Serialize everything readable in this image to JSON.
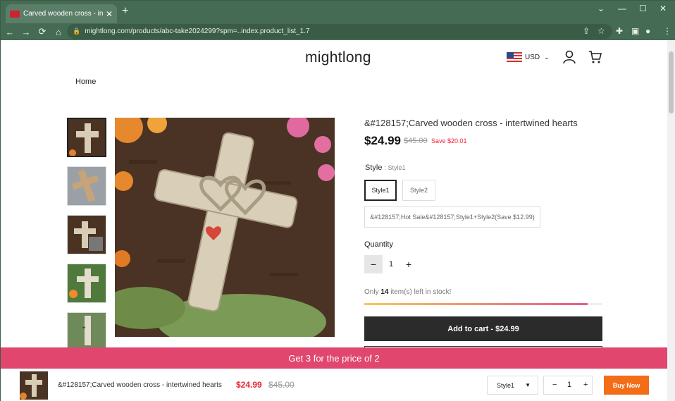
{
  "browser": {
    "tab_title": "Carved wooden cross - intertwi",
    "url": "mightlong.com/products/abc-take2024299?spm=..index.product_list_1.7"
  },
  "header": {
    "logo": "mightlong",
    "currency": "USD"
  },
  "breadcrumb": "Home",
  "product": {
    "title": "&#128157;Carved wooden cross - intertwined hearts",
    "price": "$24.99",
    "original_price": "$45.00",
    "save_text": "Save $20.01",
    "style_label": "Style",
    "style_value": ": Style1",
    "options": [
      "Style1",
      "Style2",
      "&#128157;Hot Sale&#128157;Style1+Style2(Save $12.99)"
    ],
    "quantity_label": "Quantity",
    "quantity": "1",
    "stock_prefix": "Only ",
    "stock_count": "14",
    "stock_suffix": " item(s) left in stock!",
    "stock_level": 0.94,
    "add_to_cart": "Add to cart  -  $24.99"
  },
  "promo_bar": "Get 3 for the price of 2",
  "sticky": {
    "title": "&#128157;Carved wooden cross - intertwined hearts",
    "price": "$24.99",
    "original_price": "$45.00",
    "style": "Style1",
    "quantity": "1",
    "buy_now": "Buy Now"
  },
  "colors": {
    "chrome": "#466b55",
    "promo": "#e0466e",
    "sale_red": "#e22233",
    "buy_now": "#f36d18"
  }
}
